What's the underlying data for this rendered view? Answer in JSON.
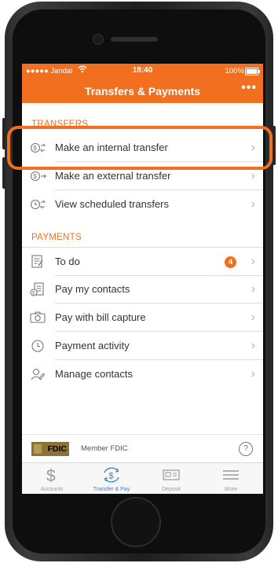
{
  "status_bar": {
    "carrier": "●●●●● Jandal",
    "time": "18:40",
    "battery": "100%"
  },
  "nav": {
    "title": "Transfers & Payments",
    "more": "•••"
  },
  "transfers": {
    "header": "TRANSFERS",
    "items": [
      {
        "label": "Make an internal transfer",
        "icon": "money-transfer-icon"
      },
      {
        "label": "Make an external transfer",
        "icon": "money-transfer-out-icon"
      },
      {
        "label": "View scheduled transfers",
        "icon": "clock-transfer-icon"
      }
    ]
  },
  "payments": {
    "header": "PAYMENTS",
    "items": [
      {
        "label": "To do",
        "icon": "checklist-icon",
        "badge": "4"
      },
      {
        "label": "Pay my contacts",
        "icon": "pay-contacts-icon"
      },
      {
        "label": "Pay with bill capture",
        "icon": "camera-icon"
      },
      {
        "label": "Payment activity",
        "icon": "history-icon"
      },
      {
        "label": "Manage contacts",
        "icon": "manage-contacts-icon"
      }
    ]
  },
  "footer": {
    "fdic_logo": "FDIC",
    "member_text": "Member FDIC",
    "help": "?"
  },
  "tabs": [
    {
      "label": "Accounts",
      "icon": "dollar-icon",
      "active": false
    },
    {
      "label": "Transfer & Pay",
      "icon": "transfer-pay-icon",
      "active": true
    },
    {
      "label": "Deposit",
      "icon": "check-deposit-icon",
      "active": false
    },
    {
      "label": "More",
      "icon": "menu-icon",
      "active": false
    }
  ],
  "colors": {
    "accent": "#f26f1f",
    "tab_active": "#3a7fd0",
    "tab_inactive": "#9a9a9a"
  }
}
